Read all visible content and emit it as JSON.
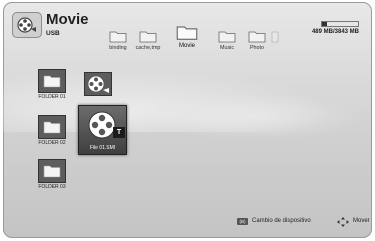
{
  "header": {
    "title": "Movie",
    "subtitle": "USB",
    "icon": "movie-reel-icon"
  },
  "breadcrumbs": [
    {
      "label": "binding",
      "active": false,
      "faded": false
    },
    {
      "label": "cache,tmp",
      "active": false,
      "faded": false
    },
    {
      "label": "Movie",
      "active": true,
      "faded": false
    },
    {
      "label": "Music",
      "active": false,
      "faded": false
    },
    {
      "label": "Photo",
      "active": false,
      "faded": false
    },
    {
      "label": "",
      "active": false,
      "faded": true
    }
  ],
  "storage": {
    "text": "489 MB/3843 MB",
    "used_fraction": 0.13
  },
  "items": [
    {
      "label": "FOLDER 01",
      "type": "folder"
    },
    {
      "label": "",
      "type": "movie"
    },
    {
      "label": "FOLDER 02",
      "type": "folder"
    },
    {
      "label": "File 01.SMI",
      "type": "movie-selected",
      "badge": "T"
    },
    {
      "label": "FOLDER 03",
      "type": "folder"
    }
  ],
  "footer": {
    "device_key": "(B)",
    "device_label": "Cambio de dispositivo",
    "move_label": "Mover",
    "move_icon": "dpad-icon"
  }
}
